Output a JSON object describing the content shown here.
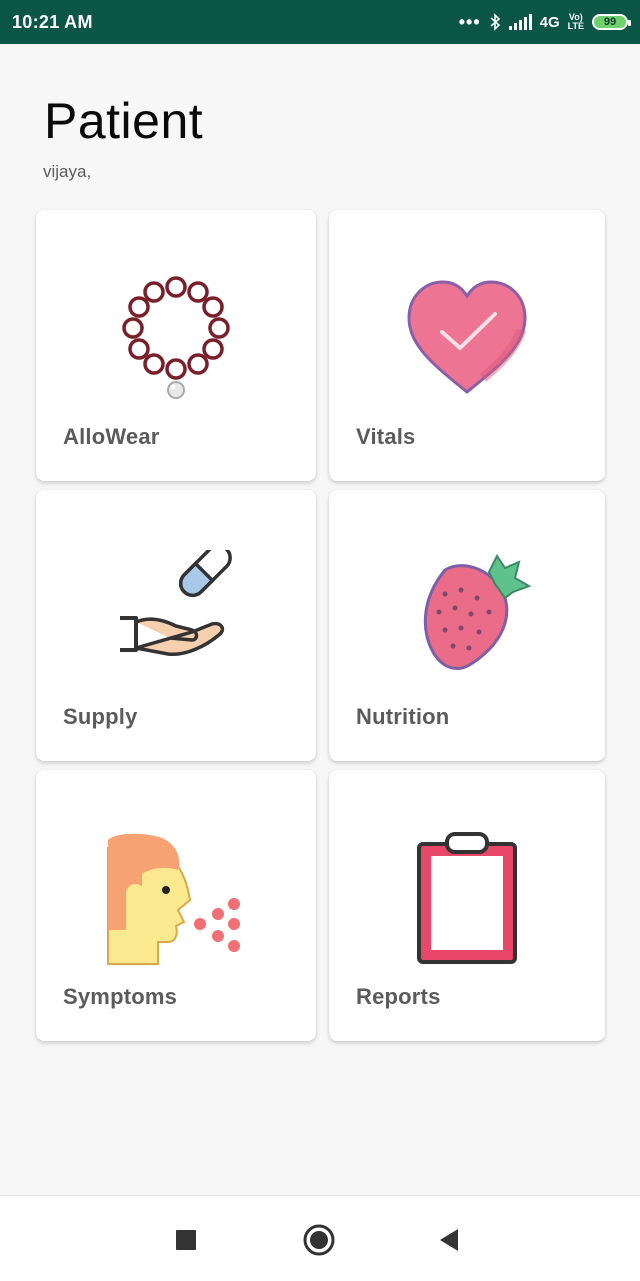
{
  "status_bar": {
    "time": "10:21 AM",
    "network": "4G",
    "volte_top": "Vo)",
    "volte_bottom": "LTE",
    "battery": "99"
  },
  "header": {
    "title": "Patient",
    "subtitle": "vijaya,"
  },
  "cards": [
    {
      "label": "AlloWear",
      "icon": "bracelet-icon"
    },
    {
      "label": "Vitals",
      "icon": "heart-check-icon"
    },
    {
      "label": "Supply",
      "icon": "pill-hand-icon"
    },
    {
      "label": "Nutrition",
      "icon": "strawberry-icon"
    },
    {
      "label": "Symptoms",
      "icon": "sneeze-icon"
    },
    {
      "label": "Reports",
      "icon": "clipboard-icon"
    }
  ],
  "nav": {
    "recent_icon": "square-icon",
    "home_icon": "circle-icon",
    "back_icon": "triangle-back-icon"
  },
  "colors": {
    "status_bar": "#0b5647",
    "background": "#f7f7f7",
    "card": "#ffffff",
    "label": "#5b5b5b"
  }
}
